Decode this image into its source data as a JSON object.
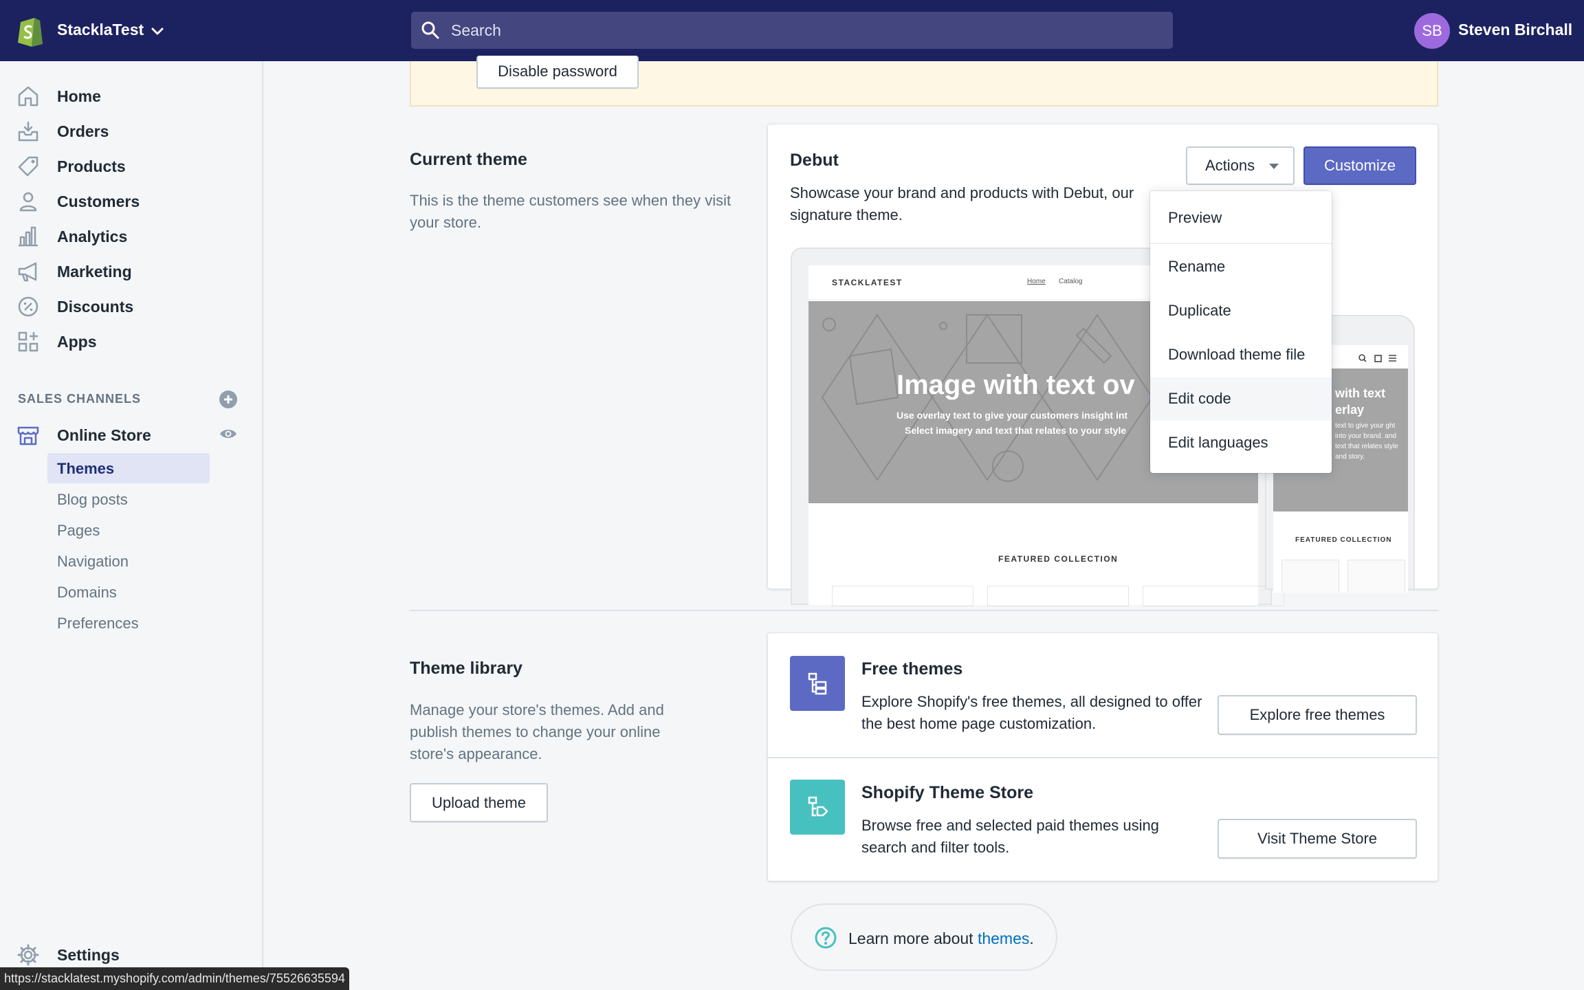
{
  "topbar": {
    "store_name": "StacklaTest",
    "search_placeholder": "Search",
    "avatar_initials": "SB",
    "user_name": "Steven Birchall"
  },
  "sidebar": {
    "items": [
      {
        "label": "Home",
        "icon": "home-icon"
      },
      {
        "label": "Orders",
        "icon": "orders-icon"
      },
      {
        "label": "Products",
        "icon": "tag-icon"
      },
      {
        "label": "Customers",
        "icon": "person-icon"
      },
      {
        "label": "Analytics",
        "icon": "bar-chart-icon"
      },
      {
        "label": "Marketing",
        "icon": "megaphone-icon"
      },
      {
        "label": "Discounts",
        "icon": "discount-icon"
      },
      {
        "label": "Apps",
        "icon": "apps-icon"
      }
    ],
    "sales_channels_title": "SALES CHANNELS",
    "online_store": "Online Store",
    "sub_items": [
      "Themes",
      "Blog posts",
      "Pages",
      "Navigation",
      "Domains",
      "Preferences"
    ],
    "settings": "Settings"
  },
  "banner": {
    "button_label": "Disable password"
  },
  "current_theme": {
    "heading": "Current theme",
    "description": "This is the theme customers see when they visit your store.",
    "theme_name": "Debut",
    "theme_description": "Showcase your brand and products with Debut, our signature theme.",
    "actions_label": "Actions",
    "customize_label": "Customize",
    "preview": {
      "brand": "STACKLATEST",
      "nav_home": "Home",
      "nav_catalog": "Catalog",
      "hero_title": "Image with text ov",
      "hero_sub1": "Use overlay text to give your customers insight int",
      "hero_sub2": "Select imagery and text that relates to your style",
      "featured": "FEATURED COLLECTION",
      "mobile_title1": "with text",
      "mobile_title2": "erlay",
      "mobile_sub": "text to give your ght into your brand. and text that relates style and story.",
      "mobile_featured": "FEATURED COLLECTION"
    }
  },
  "actions_menu": {
    "items": [
      "Preview",
      "Rename",
      "Duplicate",
      "Download theme file",
      "Edit code",
      "Edit languages"
    ]
  },
  "theme_library": {
    "heading": "Theme library",
    "description": "Manage your store's themes. Add and publish themes to change your online store's appearance.",
    "upload_label": "Upload theme",
    "free": {
      "title": "Free themes",
      "description": "Explore Shopify's free themes, all designed to offer the best home page customization.",
      "button": "Explore free themes",
      "icon_color": "#5c6ac4"
    },
    "store": {
      "title": "Shopify Theme Store",
      "description": "Browse free and selected paid themes using search and filter tools.",
      "button": "Visit Theme Store",
      "icon_color": "#47c1bf"
    }
  },
  "learn_more": {
    "prefix": "Learn more about ",
    "link": "themes",
    "suffix": "."
  },
  "status_url": "https://stacklatest.myshopify.com/admin/themes/75526635594",
  "colors": {
    "topbar": "#1c2260",
    "primary": "#5c6ac4",
    "teal": "#47c1bf",
    "link": "#006fbb"
  }
}
